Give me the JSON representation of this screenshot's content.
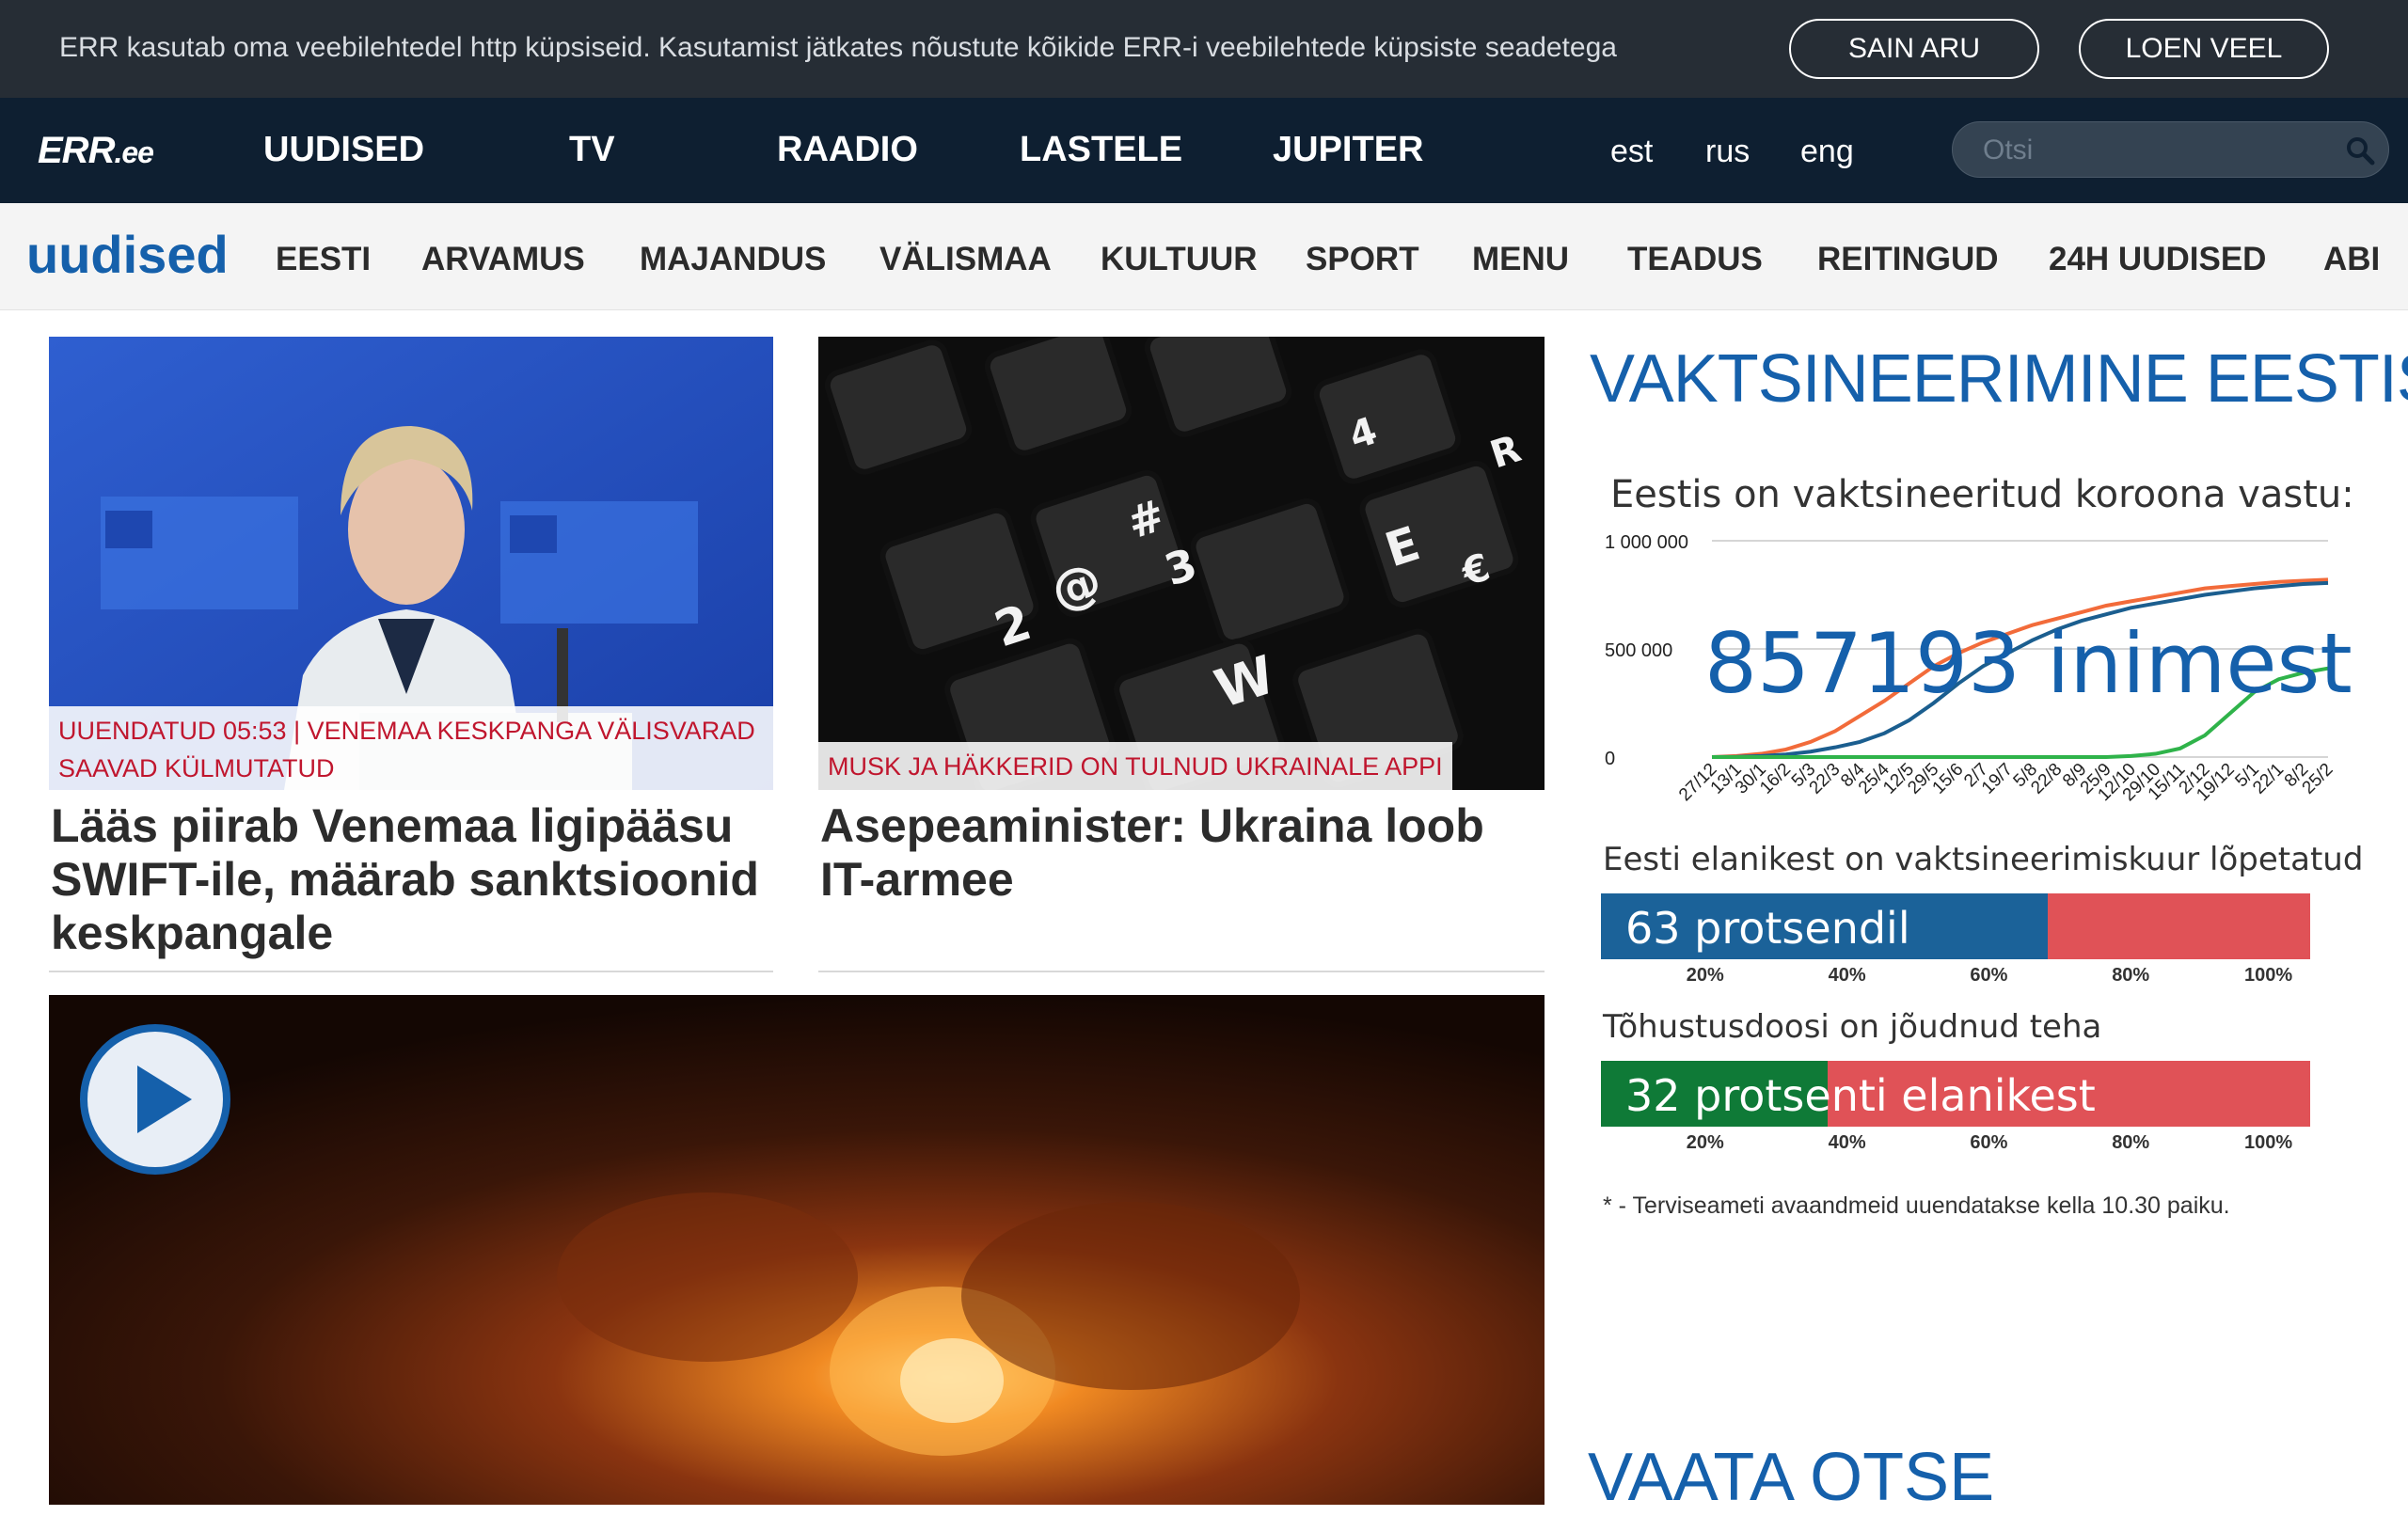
{
  "cookie": {
    "text": "ERR kasutab oma veebilehtedel http küpsiseid. Kasutamist jätkates nõustute kõikide ERR-i veebilehtede küpsiste seadetega",
    "accept": "SAIN ARU",
    "more": "LOEN VEEL"
  },
  "topnav": {
    "logo": "ERR",
    "logo_suffix": ".ee",
    "items": [
      "UUDISED",
      "TV",
      "RAADIO",
      "LASTELE",
      "JUPITER"
    ],
    "langs": [
      "est",
      "rus",
      "eng"
    ],
    "search_placeholder": "Otsi"
  },
  "subnav": {
    "section": "uudised",
    "items": [
      "EESTI",
      "ARVAMUS",
      "MAJANDUS",
      "VÄLISMAA",
      "KULTUUR",
      "SPORT",
      "MENU",
      "TEADUS",
      "REITINGUD",
      "24H UUDISED",
      "ABI"
    ]
  },
  "articles": [
    {
      "tag": "Uuendatud 05:53 | Venemaa keskpanga välisvarad saavad külmutatud",
      "title": "Lääs piirab Venemaa ligipääsu SWIFT-ile, määrab sanktsioonid keskpangale"
    },
    {
      "tag": "Musk ja häkkerid on tulnud Ukrainale appi",
      "title": "Asepeaminister: Ukraina loob IT-armee"
    }
  ],
  "sidebar": {
    "title": "VAKTSINEERIMINE EESTIS",
    "vaccinated_label": "Eestis on vaktsineeritud koroona vastu:",
    "vaccinated_count": "857193",
    "vaccinated_unit": "inimest",
    "course_label": "Eesti elanikest on vaktsineerimiskuur lõpetatud",
    "course_value": 63,
    "course_text": "63  protsendil",
    "booster_label": "Tõhustusdoosi on jõudnud teha",
    "booster_value": 32,
    "booster_text": "32  protsenti elanikest",
    "note": "* - Terviseameti avaandmeid uuendatakse kella 10.30 paiku.",
    "live_title": "VAATA OTSE"
  },
  "chart_data": {
    "type": "line",
    "y_ticks": [
      "1 000 000",
      "500 000",
      "0"
    ],
    "ylim": [
      0,
      1000000
    ],
    "x": [
      "27/12",
      "13/1",
      "30/1",
      "16/2",
      "5/3",
      "22/3",
      "8/4",
      "25/4",
      "12/5",
      "29/5",
      "15/6",
      "2/7",
      "19/7",
      "5/8",
      "22/8",
      "8/9",
      "25/9",
      "12/10",
      "29/10",
      "15/11",
      "2/12",
      "19/12",
      "5/1",
      "22/1",
      "8/2",
      "25/2"
    ],
    "series": [
      {
        "color": "#f26b3a",
        "values": [
          0,
          5000,
          15000,
          35000,
          70000,
          120000,
          190000,
          260000,
          340000,
          420000,
          480000,
          530000,
          570000,
          610000,
          640000,
          670000,
          700000,
          720000,
          740000,
          760000,
          780000,
          790000,
          800000,
          810000,
          815000,
          820000
        ]
      },
      {
        "color": "#1b5e8f",
        "values": [
          0,
          1000,
          5000,
          12000,
          25000,
          45000,
          70000,
          110000,
          170000,
          250000,
          340000,
          420000,
          480000,
          540000,
          590000,
          630000,
          660000,
          690000,
          710000,
          730000,
          750000,
          765000,
          780000,
          790000,
          800000,
          805000
        ]
      },
      {
        "color": "#2fb34a",
        "values": [
          0,
          0,
          0,
          0,
          0,
          0,
          0,
          0,
          0,
          0,
          0,
          0,
          0,
          0,
          0,
          0,
          0,
          5000,
          15000,
          40000,
          100000,
          200000,
          300000,
          360000,
          390000,
          410000
        ]
      }
    ],
    "bar_ticks": [
      "20%",
      "40%",
      "60%",
      "80%",
      "100%"
    ]
  },
  "colors": {
    "accent": "#1560ab",
    "completed": "#1b6299",
    "booster": "#0f7a37",
    "remaining": "#e05257",
    "tag": "#c0162e"
  }
}
